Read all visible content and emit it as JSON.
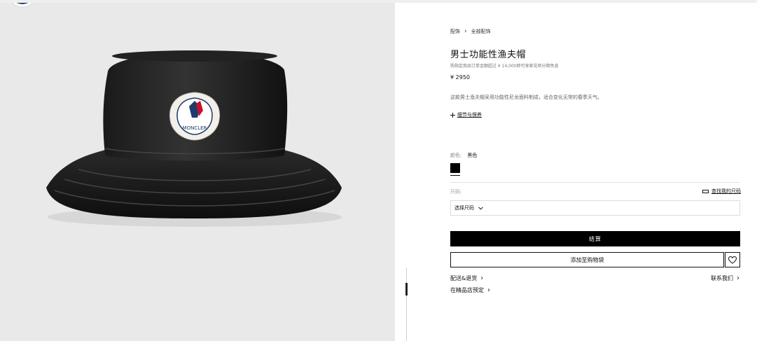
{
  "breadcrumb": {
    "items": [
      "配饰",
      "全部配饰"
    ],
    "separator": "›"
  },
  "product": {
    "title": "男士功能性渔夫帽",
    "installment_note": "购指定商品订单金额超过 ¥ 14,000即可享家花呗分期免息",
    "price": "¥ 2950",
    "description": "这款男士渔夫帽采用功能性尼龙面料制成，适合变化无常的春季天气。",
    "details_link": "细节与保养",
    "details_icon": "plus-icon",
    "brand_badge_text": "MONCLER"
  },
  "color": {
    "label": "颜色:",
    "value": "黑色",
    "swatch_hex": "#000000"
  },
  "size": {
    "label": "尺码:",
    "guide_label": "查找我的尺码",
    "guide_icon": "ruler-icon",
    "select_value": "选择尺码"
  },
  "actions": {
    "checkout_label": "结算",
    "add_to_bag_label": "添加至购物袋",
    "wishlist_icon": "heart-icon"
  },
  "links": {
    "shipping_returns": "配送&退货",
    "contact_us": "联系我们",
    "book_in_boutique": "在精品店预定"
  },
  "colors": {
    "image_bg": "#e9e9e9",
    "primary": "#000000",
    "page_bg": "#ffffff"
  }
}
